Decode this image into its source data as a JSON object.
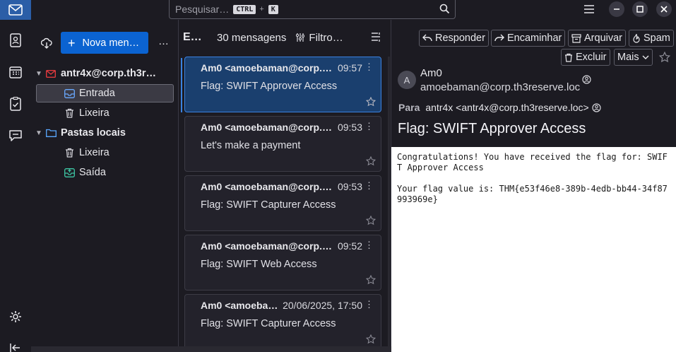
{
  "titlebar": {
    "search_placeholder": "Pesquisar…",
    "shortcut_key1": "CTRL",
    "shortcut_plus": "+",
    "shortcut_key2": "K"
  },
  "folder_pane": {
    "new_message_label": "Nova men…",
    "more_label": "…",
    "account": "antr4x@corp.th3r…",
    "folders": [
      {
        "label": "Entrada"
      },
      {
        "label": "Lixeira"
      }
    ],
    "local_folders_label": "Pastas locais",
    "local_folders": [
      {
        "label": "Lixeira"
      },
      {
        "label": "Saída"
      }
    ]
  },
  "message_list": {
    "folder_name": "E…",
    "count_label": "30 mensagens",
    "filter_label": "Filtro…",
    "messages": [
      {
        "from": "Am0 <amoebaman@corp.t…",
        "time": "09:57",
        "subject": "Flag: SWIFT Approver Access"
      },
      {
        "from": "Am0 <amoebaman@corp.t…",
        "time": "09:53",
        "subject": "Let's make a payment"
      },
      {
        "from": "Am0 <amoebaman@corp.t…",
        "time": "09:53",
        "subject": "Flag: SWIFT Capturer Access"
      },
      {
        "from": "Am0 <amoebaman@corp.t…",
        "time": "09:52",
        "subject": "Flag: SWIFT Web Access"
      },
      {
        "from": "Am0 <amoeba…",
        "time": "20/06/2025, 17:50",
        "subject": "Flag: SWIFT Capturer Access"
      }
    ]
  },
  "reader": {
    "buttons": {
      "reply": "Responder",
      "forward": "Encaminhar",
      "archive": "Arquivar",
      "spam": "Spam",
      "delete": "Excluir",
      "more": "Mais"
    },
    "avatar_letter": "A",
    "sender_name": "Am0",
    "sender_email": "amoebaman@corp.th3reserve.loc",
    "to_label": "Para",
    "to_value": "antr4x <antr4x@corp.th3reserve.loc>",
    "subject": "Flag: SWIFT Approver Access",
    "body": "Congratulations! You have received the flag for: SWIFT Approver Access\n\nYour flag value is: THM{e53f46e8-389b-4edb-bb44-34f87993969e}"
  },
  "colors": {
    "accent": "#0b63d1",
    "selected_card": "#1a3f6e",
    "background": "#1c1b22"
  }
}
